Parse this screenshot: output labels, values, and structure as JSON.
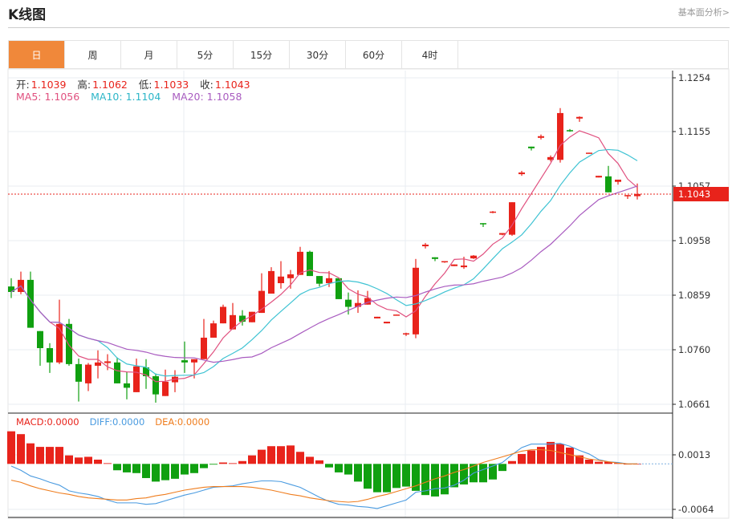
{
  "header": {
    "title": "K线图",
    "more_link": "基本面分析>"
  },
  "tabs": [
    "日",
    "周",
    "月",
    "5分",
    "15分",
    "30分",
    "60分",
    "4时"
  ],
  "active_tab": "日",
  "ohlc_info": {
    "open_label": "开:",
    "open": "1.1039",
    "high_label": "高:",
    "high": "1.1062",
    "low_label": "低:",
    "low": "1.1033",
    "close_label": "收:",
    "close": "1.1043"
  },
  "ma_info": {
    "ma5": "MA5: 1.1056",
    "ma10": "MA10: 1.1104",
    "ma20": "MA20: 1.1058"
  },
  "macd_info": {
    "macd": "MACD:0.0000",
    "diff": "DIFF:0.0000",
    "dea": "DEA:0.0000"
  },
  "current_price": "1.1043",
  "colors": {
    "up": "#e8231b",
    "down": "#10a010",
    "ma5": "#e0507f",
    "ma10": "#3fc3d3",
    "ma20": "#a95cc0",
    "diff": "#4a9be0",
    "dea": "#ef7d1e",
    "active_tab": "#f0883a"
  },
  "chart_data": [
    {
      "type": "candlestick",
      "title": "",
      "y_ticks": [
        "1.1254",
        "1.1155",
        "1.1057",
        "1.0958",
        "1.0859",
        "1.0760",
        "1.0661"
      ],
      "ylim": [
        1.0661,
        1.1254
      ],
      "grid": true,
      "ohlc": [
        [
          1.0875,
          1.089,
          1.0854,
          1.0865
        ],
        [
          1.0865,
          1.0902,
          1.0861,
          1.0887
        ],
        [
          1.0887,
          1.0902,
          1.08,
          1.08
        ],
        [
          1.0794,
          1.0794,
          1.0731,
          1.0763
        ],
        [
          1.0763,
          1.0772,
          1.0718,
          1.0737
        ],
        [
          1.0737,
          1.0851,
          1.0734,
          1.0807
        ],
        [
          1.0807,
          1.0816,
          1.0731,
          1.0734
        ],
        [
          1.0734,
          1.0744,
          1.0666,
          1.0702
        ],
        [
          1.0699,
          1.0736,
          1.0685,
          1.0733
        ],
        [
          1.0731,
          1.0759,
          1.0708,
          1.0737
        ],
        [
          1.0736,
          1.0752,
          1.0723,
          1.0739
        ],
        [
          1.0737,
          1.0746,
          1.0699,
          1.0699
        ],
        [
          1.0699,
          1.072,
          1.067,
          1.0691
        ],
        [
          1.0683,
          1.0744,
          1.0683,
          1.073
        ],
        [
          1.0728,
          1.0743,
          1.0689,
          1.0712
        ],
        [
          1.0712,
          1.0717,
          1.0664,
          1.0679
        ],
        [
          1.0676,
          1.0724,
          1.0676,
          1.0702
        ],
        [
          1.0701,
          1.0723,
          1.0683,
          1.0711
        ],
        [
          1.0741,
          1.0775,
          1.0718,
          1.0737
        ],
        [
          1.0737,
          1.0743,
          1.0708,
          1.0743
        ],
        [
          1.0743,
          1.0816,
          1.0743,
          1.0782
        ],
        [
          1.0782,
          1.0813,
          1.0782,
          1.0808
        ],
        [
          1.0808,
          1.0842,
          1.0808,
          1.0838
        ],
        [
          1.0797,
          1.0845,
          1.0797,
          1.0823
        ],
        [
          1.0822,
          1.0832,
          1.0804,
          1.0811
        ],
        [
          1.081,
          1.0829,
          1.081,
          1.0829
        ],
        [
          1.0827,
          1.0899,
          1.0827,
          1.0867
        ],
        [
          1.0862,
          1.091,
          1.0862,
          1.0903
        ],
        [
          1.0881,
          1.0921,
          1.0871,
          1.0893
        ],
        [
          1.089,
          1.0905,
          1.0871,
          1.0897
        ],
        [
          1.0896,
          1.0947,
          1.0896,
          1.0938
        ],
        [
          1.0938,
          1.094,
          1.0894,
          1.0894
        ],
        [
          1.0894,
          1.0894,
          1.0875,
          1.088
        ],
        [
          1.0881,
          1.0903,
          1.0874,
          1.089
        ],
        [
          1.089,
          1.089,
          1.0852,
          1.0852
        ],
        [
          1.0851,
          1.0864,
          1.0824,
          1.0838
        ],
        [
          1.0838,
          1.0868,
          1.0827,
          1.0845
        ],
        [
          1.0842,
          1.0867,
          1.0842,
          1.0854
        ],
        [
          1.0817,
          1.082,
          1.0817,
          1.082
        ],
        [
          1.0808,
          1.0811,
          1.0808,
          1.0811
        ],
        [
          1.0822,
          1.0824,
          1.0822,
          1.0824
        ],
        [
          1.0788,
          1.0791,
          1.0785,
          1.079
        ],
        [
          1.0788,
          1.0925,
          1.0781,
          1.0909
        ],
        [
          1.0948,
          1.0954,
          1.0944,
          1.0951
        ],
        [
          1.0928,
          1.0928,
          1.0921,
          1.0925
        ],
        [
          1.0919,
          1.0921,
          1.0918,
          1.0921
        ],
        [
          1.0912,
          1.0915,
          1.0912,
          1.0915
        ],
        [
          1.091,
          1.0929,
          1.0907,
          1.0913
        ],
        [
          1.0926,
          1.0932,
          1.0925,
          1.0931
        ],
        [
          1.099,
          1.099,
          1.0983,
          1.0989
        ],
        [
          1.1009,
          1.1012,
          1.1008,
          1.1011
        ],
        [
          1.0969,
          1.0972,
          1.0968,
          1.0972
        ],
        [
          1.0969,
          1.1028,
          1.0967,
          1.1028
        ],
        [
          1.1079,
          1.1085,
          1.1076,
          1.1082
        ],
        [
          1.1129,
          1.1129,
          1.1122,
          1.1126
        ],
        [
          1.1145,
          1.1151,
          1.1142,
          1.1148
        ],
        [
          1.1105,
          1.1113,
          1.1102,
          1.111
        ],
        [
          1.1105,
          1.1199,
          1.11,
          1.119
        ],
        [
          1.1159,
          1.1161,
          1.1156,
          1.1158
        ],
        [
          1.118,
          1.1184,
          1.1174,
          1.1183
        ],
        [
          1.1117,
          1.1118,
          1.1117,
          1.1118
        ],
        [
          1.1073,
          1.1076,
          1.1073,
          1.1076
        ],
        [
          1.1075,
          1.1094,
          1.1046,
          1.1046
        ],
        [
          1.1065,
          1.1069,
          1.106,
          1.1069
        ],
        [
          1.1039,
          1.1041,
          1.1034,
          1.1041
        ],
        [
          1.1039,
          1.1062,
          1.1033,
          1.1043
        ]
      ],
      "ma_periods": [
        5,
        10,
        20
      ]
    },
    {
      "type": "bar+line",
      "title": "",
      "y_ticks": [
        "0.0013",
        "-0.0064"
      ],
      "macd": [
        0.0046,
        0.0042,
        0.0029,
        0.0024,
        0.0024,
        0.0024,
        0.0012,
        0.0009,
        0.001,
        0.0006,
        0.0001,
        -0.0009,
        -0.0012,
        -0.0013,
        -0.002,
        -0.0025,
        -0.0023,
        -0.0021,
        -0.0015,
        -0.0013,
        -0.0006,
        -0.0001,
        0.0002,
        0.0001,
        0.0004,
        0.0012,
        0.002,
        0.0025,
        0.0025,
        0.0026,
        0.0017,
        0.001,
        0.0005,
        -0.0005,
        -0.0012,
        -0.0015,
        -0.0025,
        -0.0035,
        -0.004,
        -0.004,
        -0.0034,
        -0.0032,
        -0.0038,
        -0.0044,
        -0.0046,
        -0.0043,
        -0.0033,
        -0.0029,
        -0.0026,
        -0.0026,
        -0.0022,
        -0.001,
        0.0004,
        0.0014,
        0.0019,
        0.0024,
        0.0031,
        0.0028,
        0.0023,
        0.0012,
        0.0006,
        0.0003,
        0.0003,
        0.0001,
        0.0,
        0.0
      ],
      "diff": [
        -0.0003,
        -0.0009,
        -0.0017,
        -0.0021,
        -0.0026,
        -0.003,
        -0.0038,
        -0.0041,
        -0.0043,
        -0.0046,
        -0.0051,
        -0.0055,
        -0.0055,
        -0.0055,
        -0.0057,
        -0.0056,
        -0.0052,
        -0.0048,
        -0.0044,
        -0.0041,
        -0.0037,
        -0.0033,
        -0.0032,
        -0.0031,
        -0.0028,
        -0.0026,
        -0.0024,
        -0.0024,
        -0.0025,
        -0.0029,
        -0.0033,
        -0.004,
        -0.0047,
        -0.0053,
        -0.0057,
        -0.0058,
        -0.006,
        -0.0061,
        -0.0063,
        -0.0059,
        -0.0055,
        -0.0051,
        -0.004,
        -0.0038,
        -0.0035,
        -0.0034,
        -0.003,
        -0.0023,
        -0.0013,
        -0.0008,
        -0.0003,
        0.0002,
        0.0013,
        0.0023,
        0.0028,
        0.0028,
        0.0028,
        0.0029,
        0.0025,
        0.0019,
        0.0014,
        0.0006,
        0.0003,
        0.0002,
        0.0,
        0.0
      ],
      "dea": [
        -0.0023,
        -0.0026,
        -0.0031,
        -0.0035,
        -0.0038,
        -0.0041,
        -0.0043,
        -0.0046,
        -0.0048,
        -0.0049,
        -0.005,
        -0.0051,
        -0.0051,
        -0.0049,
        -0.0048,
        -0.0045,
        -0.0043,
        -0.004,
        -0.0037,
        -0.0035,
        -0.0033,
        -0.0032,
        -0.0032,
        -0.0032,
        -0.0032,
        -0.0033,
        -0.0035,
        -0.0037,
        -0.004,
        -0.0043,
        -0.0045,
        -0.0048,
        -0.005,
        -0.0052,
        -0.0053,
        -0.0054,
        -0.0053,
        -0.005,
        -0.0046,
        -0.0043,
        -0.0039,
        -0.0035,
        -0.0031,
        -0.0026,
        -0.0021,
        -0.0017,
        -0.0012,
        -0.0008,
        -0.0003,
        0.0002,
        0.0006,
        0.001,
        0.0014,
        0.0018,
        0.002,
        0.002,
        0.0019,
        0.0016,
        0.0013,
        0.001,
        0.0007,
        0.0005,
        0.0003,
        0.0001,
        0.0,
        0.0
      ]
    }
  ]
}
